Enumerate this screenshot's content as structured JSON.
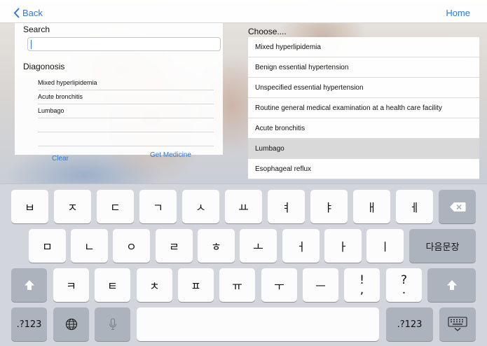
{
  "nav": {
    "back_label": "Back",
    "home_label": "Home"
  },
  "left": {
    "search_label": "Search",
    "search_value": "",
    "diagnosis_label": "Diagonosis",
    "diagnoses": [
      "Mixed hyperlipidemia",
      "Acute bronchitis",
      "Lumbago",
      "",
      ""
    ],
    "clear_label": "Clear",
    "get_medicine_label": "Get Medicine"
  },
  "right": {
    "choose_label": "Choose....",
    "options": [
      "Mixed hyperlipidemia",
      "Benign essential hypertension",
      "Unspecified essential hypertension",
      "Routine general medical examination at a health care facility",
      "Acute bronchitis",
      "Lumbago",
      "Esophageal reflux"
    ],
    "selected_option": "Lumbago"
  },
  "keyboard": {
    "row1": [
      "ㅂ",
      "ㅈ",
      "ㄷ",
      "ㄱ",
      "ㅅ",
      "ㅛ",
      "ㅕ",
      "ㅑ",
      "ㅐ",
      "ㅔ"
    ],
    "row2": [
      "ㅁ",
      "ㄴ",
      "ㅇ",
      "ㄹ",
      "ㅎ",
      "ㅗ",
      "ㅓ",
      "ㅏ",
      "ㅣ"
    ],
    "return_label": "다음문장",
    "row3": [
      "ㅋ",
      "ㅌ",
      "ㅊ",
      "ㅍ",
      "ㅠ",
      "ㅜ",
      "ㅡ"
    ],
    "punct1_top": "!",
    "punct1_bottom": ",",
    "punct2_top": "?",
    "punct2_bottom": ".",
    "numbers_label": ".?123"
  },
  "colors": {
    "accent": "#2f7ad8",
    "keyboard_bg": "#d2d6dc",
    "key_dark": "#adb3bc",
    "selected_row": "#d9d9d9"
  }
}
